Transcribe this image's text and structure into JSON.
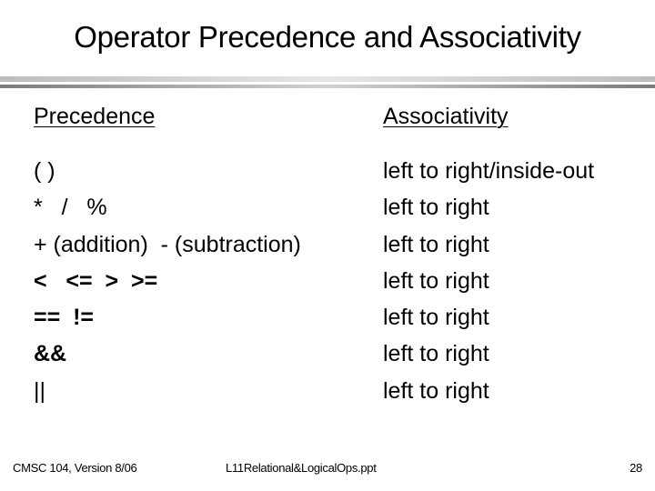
{
  "slide": {
    "title": "Operator Precedence and Associativity",
    "headers": {
      "precedence": "Precedence",
      "associativity": "Associativity"
    },
    "rows": [
      {
        "operators": "( )",
        "associativity": "left to right/inside-out",
        "bold": false
      },
      {
        "operators": "*   /   %",
        "associativity": "left to right",
        "bold": false
      },
      {
        "operators": "+ (addition)  - (subtraction)",
        "associativity": "left to right",
        "bold": false
      },
      {
        "operators": "<   <=  >  >=",
        "associativity": "left to right",
        "bold": true
      },
      {
        "operators": "==  !=",
        "associativity": "left to right",
        "bold": true
      },
      {
        "operators": "&&",
        "associativity": "left to right",
        "bold": true
      },
      {
        "operators": "||",
        "associativity": "left to right",
        "bold": false
      }
    ],
    "footer": {
      "course": "CMSC 104, Version 8/06",
      "filename": "L11Relational&LogicalOps.ppt",
      "page_number": "28"
    }
  }
}
